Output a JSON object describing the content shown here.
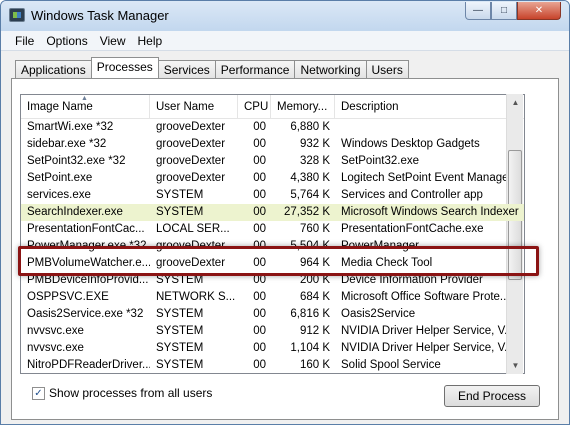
{
  "window": {
    "title": "Windows Task Manager"
  },
  "menu": [
    "File",
    "Options",
    "View",
    "Help"
  ],
  "tabs": [
    "Applications",
    "Processes",
    "Services",
    "Performance",
    "Networking",
    "Users"
  ],
  "active_tab": "Processes",
  "columns": [
    "Image Name",
    "User Name",
    "CPU",
    "Memory...",
    "Description"
  ],
  "processes": [
    {
      "image": "SmartWi.exe *32",
      "user": "grooveDexter",
      "cpu": "00",
      "mem": "6,880 K",
      "desc": ""
    },
    {
      "image": "sidebar.exe *32",
      "user": "grooveDexter",
      "cpu": "00",
      "mem": "932 K",
      "desc": "Windows Desktop Gadgets"
    },
    {
      "image": "SetPoint32.exe *32",
      "user": "grooveDexter",
      "cpu": "00",
      "mem": "328 K",
      "desc": "SetPoint32.exe"
    },
    {
      "image": "SetPoint.exe",
      "user": "grooveDexter",
      "cpu": "00",
      "mem": "4,380 K",
      "desc": "Logitech SetPoint Event Manage..."
    },
    {
      "image": "services.exe",
      "user": "SYSTEM",
      "cpu": "00",
      "mem": "5,764 K",
      "desc": "Services and Controller app"
    },
    {
      "image": "SearchIndexer.exe",
      "user": "SYSTEM",
      "cpu": "00",
      "mem": "27,352 K",
      "desc": "Microsoft Windows Search Indexer"
    },
    {
      "image": "PresentationFontCac...",
      "user": "LOCAL SER...",
      "cpu": "00",
      "mem": "760 K",
      "desc": "PresentationFontCache.exe"
    },
    {
      "image": "PowerManager.exe *32",
      "user": "grooveDexter",
      "cpu": "00",
      "mem": "5,504 K",
      "desc": "PowerManager"
    },
    {
      "image": "PMBVolumeWatcher.e...",
      "user": "grooveDexter",
      "cpu": "00",
      "mem": "964 K",
      "desc": "Media Check Tool"
    },
    {
      "image": "PMBDeviceInfoProvid...",
      "user": "SYSTEM",
      "cpu": "00",
      "mem": "200 K",
      "desc": "Device Information Provider"
    },
    {
      "image": "OSPPSVC.EXE",
      "user": "NETWORK S...",
      "cpu": "00",
      "mem": "684 K",
      "desc": "Microsoft Office Software Prote..."
    },
    {
      "image": "Oasis2Service.exe *32",
      "user": "SYSTEM",
      "cpu": "00",
      "mem": "6,816 K",
      "desc": "Oasis2Service"
    },
    {
      "image": "nvvsvc.exe",
      "user": "SYSTEM",
      "cpu": "00",
      "mem": "912 K",
      "desc": "NVIDIA Driver Helper Service, V..."
    },
    {
      "image": "nvvsvc.exe",
      "user": "SYSTEM",
      "cpu": "00",
      "mem": "1,104 K",
      "desc": "NVIDIA Driver Helper Service, V..."
    },
    {
      "image": "NitroPDFReaderDriver...",
      "user": "SYSTEM",
      "cpu": "00",
      "mem": "160 K",
      "desc": "Solid Spool Service"
    }
  ],
  "highlighted_image": "SearchIndexer.exe",
  "show_all": {
    "label": "Show processes from all users",
    "checked": true,
    "check_glyph": "✓"
  },
  "end_process_label": "End Process",
  "colors": {
    "highlight_border": "#8b1414",
    "highlight_fill": "#edf3cf"
  },
  "captions": {
    "minimize": "—",
    "maximize": "□",
    "close": "✕"
  }
}
